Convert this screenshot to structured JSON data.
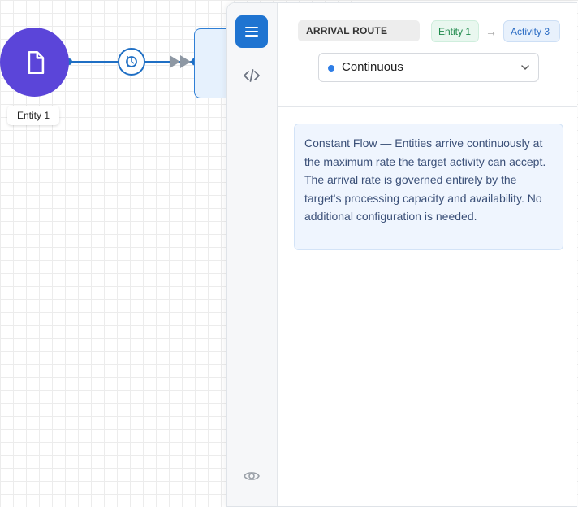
{
  "canvas": {
    "entity": {
      "label": "Entity 1",
      "icon": "document-icon",
      "color": "#5b45d9"
    },
    "connector": {
      "badge_icon": "timer-badge-icon",
      "arrow_icon": "double-arrow-icon"
    },
    "activity_node": {
      "color": "#2f7fd6"
    }
  },
  "panel": {
    "rail": [
      {
        "name": "menu",
        "icon": "menu-icon",
        "active": true
      },
      {
        "name": "code",
        "icon": "code-icon",
        "active": false
      },
      {
        "name": "preview",
        "icon": "eye-icon",
        "active": false
      }
    ],
    "header": {
      "title": "ARRIVAL ROUTE",
      "from": "Entity 1",
      "arrow": "→",
      "to": "Activity 3"
    },
    "mode_select": {
      "value": "Continuous",
      "dot_color": "#2f7ee6"
    },
    "info": "Constant Flow — Entities arrive continuously at the maximum rate the target activity can accept. The arrival rate is governed entirely by the target's processing capacity and availability. No additional configuration is needed."
  },
  "colors": {
    "accent": "#1f74d1",
    "from_chip": "#1f8a4c",
    "to_chip": "#2b6cc4"
  }
}
